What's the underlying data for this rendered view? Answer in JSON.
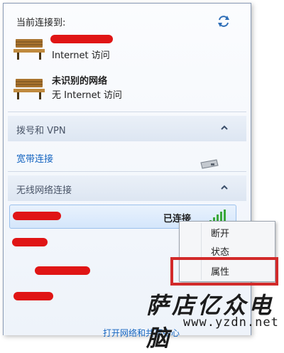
{
  "header": {
    "label": "当前连接到:"
  },
  "connections": [
    {
      "name": "",
      "status": "Internet 访问"
    },
    {
      "name": "未识别的网络",
      "status": "无 Internet 访问"
    }
  ],
  "sections": {
    "dialup": {
      "title": "拨号和 VPN",
      "link": "宽带连接"
    },
    "wireless": {
      "title": "无线网络连接",
      "connected_status": "已连接"
    }
  },
  "context_menu": {
    "items": [
      "断开",
      "状态",
      "属性"
    ]
  },
  "footer": {
    "link": "打开网络和共享中心"
  },
  "watermark": {
    "cn": "萨店亿众电脑",
    "url": "www.yzdn.net"
  },
  "colors": {
    "link": "#1565c0",
    "redaction": "#e01515",
    "highlight_box": "#d22a2a"
  }
}
